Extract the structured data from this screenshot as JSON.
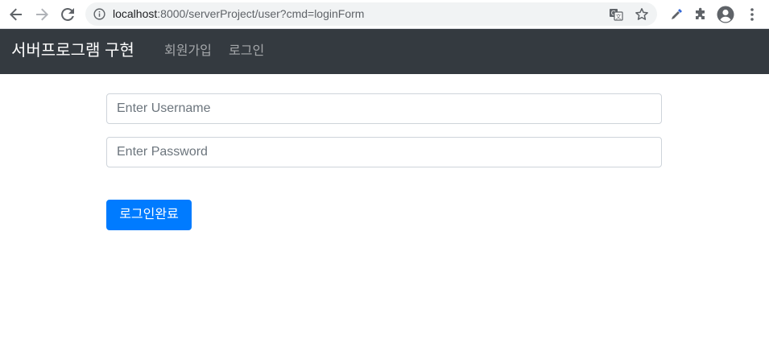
{
  "browser": {
    "url_host": "localhost",
    "url_rest": ":8000/serverProject/user?cmd=loginForm",
    "icons": [
      "back-arrow-icon",
      "forward-arrow-icon",
      "reload-icon",
      "info-icon",
      "translate-icon",
      "star-icon",
      "eyedropper-icon",
      "puzzle-icon",
      "profile-icon",
      "kebab-menu-icon"
    ]
  },
  "navbar": {
    "brand": "서버프로그램 구현",
    "links": [
      "회원가입",
      "로그인"
    ],
    "background": "#343a40"
  },
  "form": {
    "username_placeholder": "Enter Username",
    "username_value": "",
    "password_placeholder": "Enter Password",
    "password_value": "",
    "submit_label": "로그인완료",
    "submit_color": "#007bff"
  }
}
